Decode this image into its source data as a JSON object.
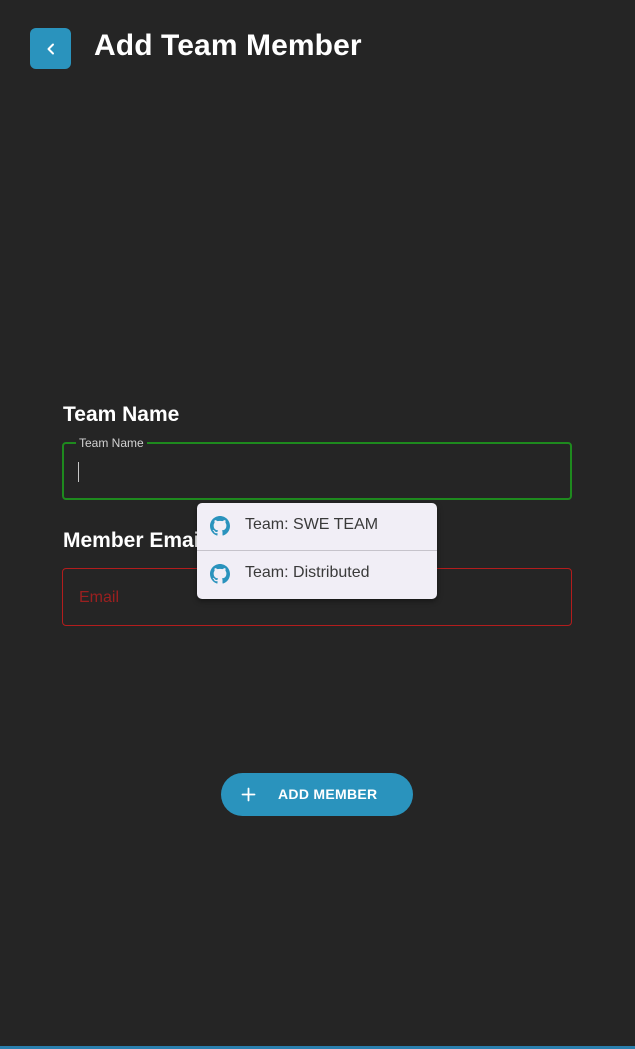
{
  "header": {
    "back_icon": "chevron-left-icon",
    "title": "Add Team Member"
  },
  "team_name": {
    "section_label": "Team Name",
    "field_label": "Team Name",
    "value": ""
  },
  "member_email": {
    "section_label": "Member Email",
    "placeholder": "Email",
    "value": ""
  },
  "suggestions": [
    {
      "icon": "github-icon",
      "label": "Team: SWE TEAM"
    },
    {
      "icon": "github-icon",
      "label": "Team: Distributed"
    }
  ],
  "add_button": {
    "icon": "plus-icon",
    "label": "ADD MEMBER"
  },
  "colors": {
    "background": "#252525",
    "accent": "#2a93bd",
    "valid_border": "#1e8a1e",
    "error_border": "#b31d1d",
    "suggestion_bg": "#f1eef6"
  }
}
